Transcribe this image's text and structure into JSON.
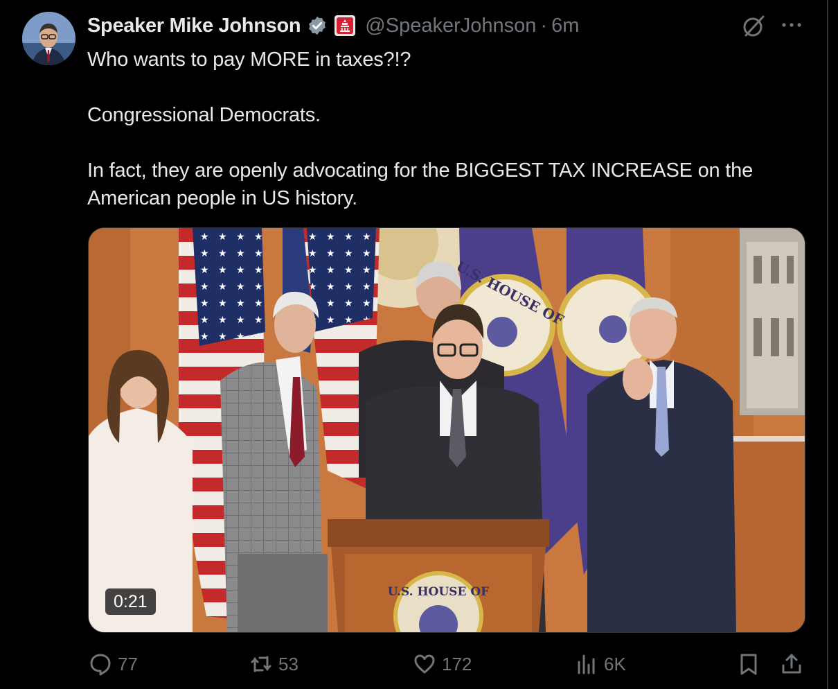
{
  "author": {
    "name": "Speaker Mike Johnson",
    "handle": "@SpeakerJohnson",
    "separator": "·",
    "time": "6m"
  },
  "tweet": {
    "paragraphs": [
      "Who wants to pay MORE in taxes?!?",
      "Congressional Democrats.",
      "In fact, they are openly advocating for the BIGGEST TAX INCREASE on the American people in US history."
    ]
  },
  "media": {
    "duration": "0:21",
    "podium_seal_text": "U.S. HOUSE OF",
    "flag_seal_text": "U.S. HOUSE OF"
  },
  "actions": {
    "replies": "77",
    "reposts": "53",
    "likes": "172",
    "views": "6K"
  },
  "colors": {
    "background": "#000000",
    "text": "#e7e9ea",
    "muted": "#71767b",
    "verified": "#1d9bf0",
    "border": "#2f3336"
  }
}
